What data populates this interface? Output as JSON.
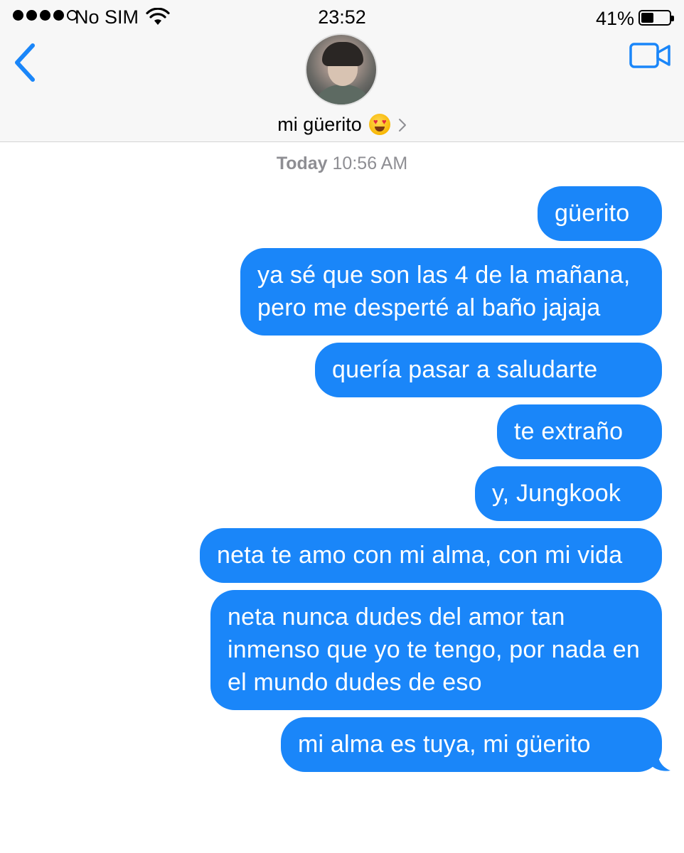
{
  "status_bar": {
    "carrier": "No SIM",
    "time": "23:52",
    "battery_percent": "41%",
    "battery_level": 0.41,
    "signal_bars_filled": 4,
    "signal_bars_total": 5
  },
  "header": {
    "contact_name": "mi güerito",
    "contact_emoji": "smiling-face-with-heart-eyes",
    "back_icon": "chevron-left-icon",
    "video_icon": "video-camera-icon",
    "accent_color": "#1a86f9"
  },
  "thread": {
    "timestamp_day": "Today",
    "timestamp_time": "10:56 AM",
    "bubble_color": "#1a86f9",
    "messages": [
      {
        "text": "güerito"
      },
      {
        "text": "ya sé que son las 4 de la mañana, pero me desperté al baño jajaja"
      },
      {
        "text": "quería pasar a saludarte"
      },
      {
        "text": "te extraño"
      },
      {
        "text": "y, Jungkook"
      },
      {
        "text": "neta te amo con mi alma, con mi vida"
      },
      {
        "text": "neta nunca dudes del amor tan inmenso que yo te tengo, por nada en el mundo dudes de eso"
      },
      {
        "text": "mi alma es tuya, mi güerito"
      }
    ]
  }
}
